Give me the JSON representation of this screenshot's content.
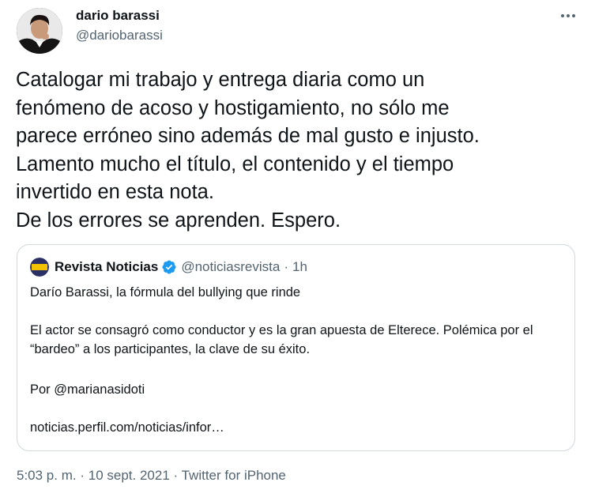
{
  "author": {
    "name": "dario barassi",
    "handle": "@dariobarassi",
    "avatar_icon": "profile-photo"
  },
  "more_icon": "more-horizontal-icon",
  "tweet_text": "Catalogar mi trabajo y entrega diaria como un\nfenómeno de acoso y hostigamiento, no sólo me\nparece erróneo sino además de mal gusto e injusto.\nLamento mucho el título, el contenido y el tiempo\ninvertido en esta nota.\nDe los errores se aprenden. Espero.",
  "quote": {
    "name": "Revista Noticias",
    "verified": true,
    "handle": "@noticiasrevista",
    "separator": "·",
    "time": "1h",
    "avatar_label": "NOTICIAS",
    "title": "Darío Barassi, la fórmula del bullying que rinde",
    "description": "El actor se consagró como conductor y es la gran apuesta de Elterece. Polémica por el “bardeo” a los participantes, la clave de su éxito.",
    "byline": "Por @marianasidoti",
    "link": "noticias.perfil.com/noticias/infor…"
  },
  "timestamp": {
    "time": "5:03 p. m.",
    "separator1": "·",
    "date": "10 sept. 2021",
    "separator2": "·",
    "source": "Twitter for iPhone"
  },
  "colors": {
    "text": "#0f1419",
    "secondary": "#536471",
    "border": "#cfd9de",
    "verified": "#1d9bf0"
  }
}
